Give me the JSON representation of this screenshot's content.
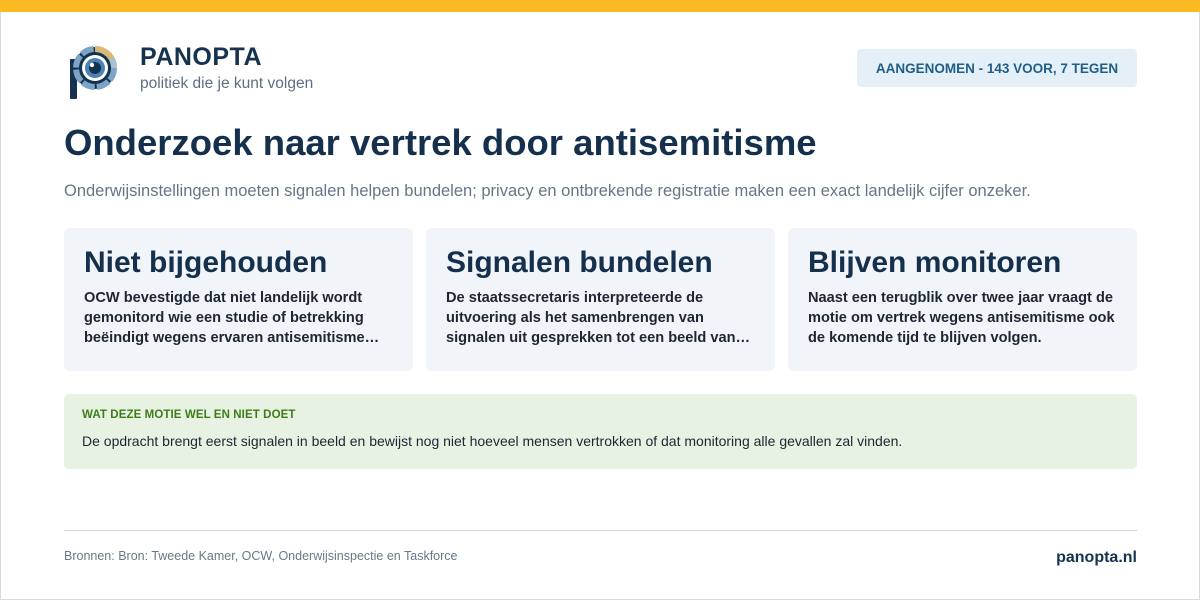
{
  "brand": {
    "name": "PANOPTA",
    "tagline": "politiek die je kunt volgen"
  },
  "status": {
    "label": "AANGENOMEN - 143 VOOR, 7 TEGEN"
  },
  "headline": {
    "title": "Onderzoek naar vertrek door antisemitisme",
    "subtitle": "Onderwijsinstellingen moeten signalen helpen bundelen; privacy en ontbrekende registratie maken een exact landelijk cijfer onzeker."
  },
  "cards": [
    {
      "title": "Niet bijgehouden",
      "body": "OCW bevestigde dat niet landelijk wordt gemonitord wie een studie of betrekking beëindigt wegens ervaren antisemitisme of…"
    },
    {
      "title": "Signalen bundelen",
      "body": "De staatssecretaris interpreteerde de uitvoering als het samenbrengen van signalen uit gesprekken tot een beeld van…"
    },
    {
      "title": "Blijven monitoren",
      "body": "Naast een terugblik over twee jaar vraagt de motie om vertrek wegens antisemitisme ook de komende tijd te blijven volgen."
    }
  ],
  "callout": {
    "label": "WAT DEZE MOTIE WEL EN NIET DOET",
    "text": "De opdracht brengt eerst signalen in beeld en bewijst nog niet hoeveel mensen vertrokken of dat monitoring alle gevallen zal vinden."
  },
  "footer": {
    "sources": "Bronnen: Bron: Tweede Kamer, OCW, Onderwijsinspectie en Taskforce",
    "site": "panopta.nl"
  },
  "colors": {
    "accent_bar": "#fbba21",
    "primary_text": "#14304d",
    "badge_bg": "#e5eff8",
    "badge_text": "#1f5f87",
    "card_bg": "#f1f4f8",
    "callout_bg": "#e8f2e3",
    "callout_label": "#3c7d1a"
  },
  "icons": {
    "logo": "eye-p-logo-icon"
  }
}
